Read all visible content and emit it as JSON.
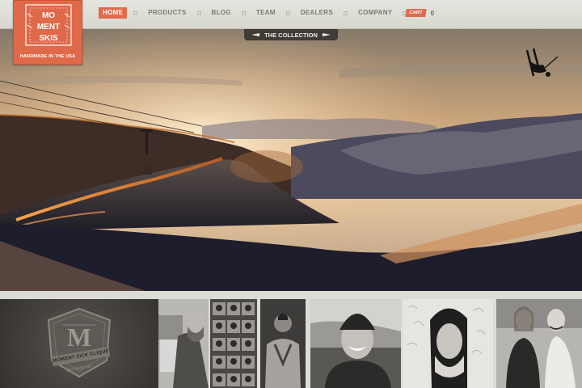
{
  "nav": {
    "items": [
      {
        "label": "HOME",
        "active": true
      },
      {
        "label": "PRODUCTS",
        "active": false
      },
      {
        "label": "BLOG",
        "active": false
      },
      {
        "label": "TEAM",
        "active": false
      },
      {
        "label": "DEALERS",
        "active": false
      },
      {
        "label": "COMPANY",
        "active": false
      }
    ],
    "cart_label": "CART",
    "cart_count": "0"
  },
  "logo": {
    "lines": [
      "MO",
      "MENT",
      "SKIS"
    ],
    "tagline": "HANDMADE IN THE USA"
  },
  "hero": {
    "collection_label": "THE COLLECTION"
  },
  "team": {
    "clique_label": "MOMENT SICK CLIQUE",
    "clique_sub": "EST. RENO NV"
  },
  "colors": {
    "accent": "#e26a4b",
    "nav_text": "#7b7b74",
    "topbar": "#dcdcd6",
    "dark_tab": "#3f3c38"
  }
}
